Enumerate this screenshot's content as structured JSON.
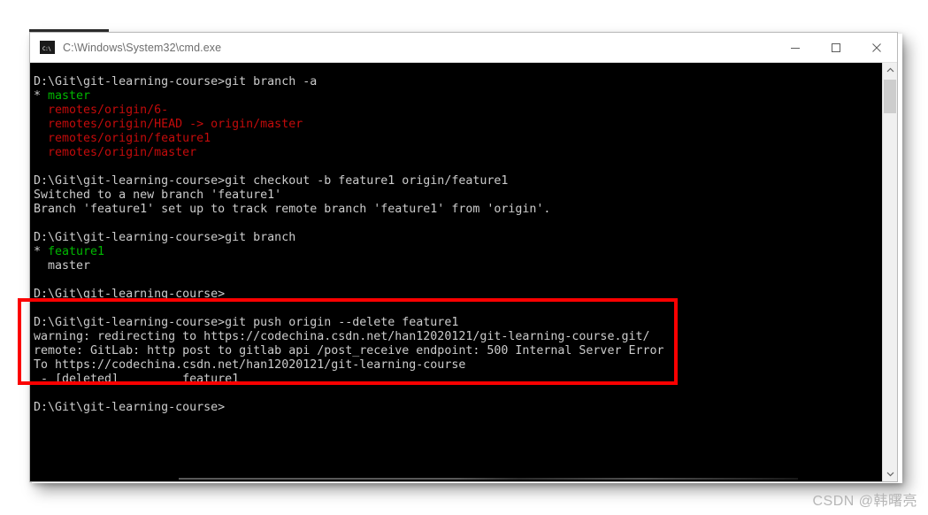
{
  "window": {
    "title": "C:\\Windows\\System32\\cmd.exe",
    "icon": "cmd-icon",
    "prompt_glyph": "C:\\",
    "controls": {
      "minimize_label": "Minimize",
      "maximize_label": "Maximize",
      "close_label": "Close"
    }
  },
  "colors": {
    "terminal_bg": "#000000",
    "text_default": "#cccccc",
    "text_green": "#00b700",
    "text_red": "#c30b0b",
    "annotation_red": "#fb0000",
    "titlebar_bg": "#ffffff",
    "title_text": "#6e6e6e",
    "scrollbar_track": "#f0f0f0",
    "scrollbar_thumb": "#cdcdcd"
  },
  "terminal": {
    "lines": [
      {
        "id": "l01",
        "color": "white",
        "text": "D:\\Git\\git-learning-course>git branch -a"
      },
      {
        "id": "l02",
        "color": "green",
        "text": "* master",
        "prefix": "* ",
        "prefix_color": "white"
      },
      {
        "id": "l03",
        "color": "red",
        "text": "  remotes/origin/6-"
      },
      {
        "id": "l04",
        "color": "red",
        "text": "  remotes/origin/HEAD -> origin/master"
      },
      {
        "id": "l05",
        "color": "red",
        "text": "  remotes/origin/feature1"
      },
      {
        "id": "l06",
        "color": "red",
        "text": "  remotes/origin/master"
      },
      {
        "id": "l07",
        "color": "white",
        "text": ""
      },
      {
        "id": "l08",
        "color": "white",
        "text": "D:\\Git\\git-learning-course>git checkout -b feature1 origin/feature1"
      },
      {
        "id": "l09",
        "color": "white",
        "text": "Switched to a new branch 'feature1'"
      },
      {
        "id": "l10",
        "color": "white",
        "text": "Branch 'feature1' set up to track remote branch 'feature1' from 'origin'."
      },
      {
        "id": "l11",
        "color": "white",
        "text": ""
      },
      {
        "id": "l12",
        "color": "white",
        "text": "D:\\Git\\git-learning-course>git branch"
      },
      {
        "id": "l13",
        "color": "green",
        "text": "* feature1",
        "prefix": "* ",
        "prefix_color": "white"
      },
      {
        "id": "l14",
        "color": "white",
        "text": "  master"
      },
      {
        "id": "l15",
        "color": "white",
        "text": ""
      },
      {
        "id": "l16",
        "color": "white",
        "text": "D:\\Git\\git-learning-course>"
      },
      {
        "id": "l17",
        "color": "white",
        "text": ""
      },
      {
        "id": "l18",
        "color": "white",
        "text": "D:\\Git\\git-learning-course>git push origin --delete feature1"
      },
      {
        "id": "l19",
        "color": "white",
        "text": "warning: redirecting to https://codechina.csdn.net/han12020121/git-learning-course.git/"
      },
      {
        "id": "l20",
        "color": "white",
        "text": "remote: GitLab: http post to gitlab api /post_receive endpoint: 500 Internal Server Error"
      },
      {
        "id": "l21",
        "color": "white",
        "text": "To https://codechina.csdn.net/han12020121/git-learning-course"
      },
      {
        "id": "l22",
        "color": "white",
        "text": " - [deleted]         feature1"
      },
      {
        "id": "l23",
        "color": "white",
        "text": ""
      },
      {
        "id": "l24",
        "color": "white",
        "text": "D:\\Git\\git-learning-course>"
      }
    ]
  },
  "annotation": {
    "type": "red-rectangle-highlight",
    "label": "highlight around git push origin --delete feature1 output"
  },
  "watermark": {
    "text": "CSDN @韩曙亮"
  }
}
